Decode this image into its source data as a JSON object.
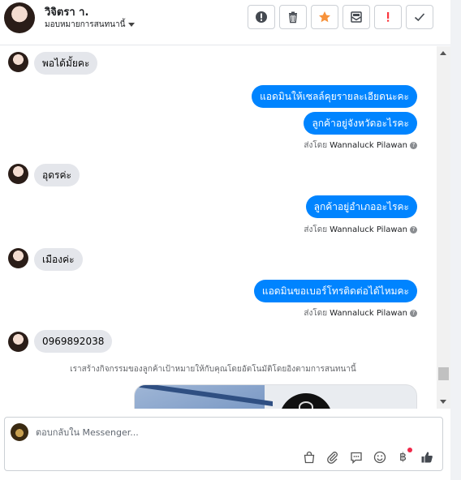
{
  "header": {
    "name": "วิจิตรา า.",
    "assign_label": "มอบหมายการสนทนานี้"
  },
  "toolbar": {
    "buttons": [
      {
        "icon": "alert-circle-icon",
        "color": "#444950"
      },
      {
        "icon": "trash-icon",
        "color": "#444950"
      },
      {
        "icon": "star-icon",
        "color": "#f7923b"
      },
      {
        "icon": "envelope-icon",
        "color": "#444950"
      },
      {
        "icon": "exclamation-icon",
        "color": "#fa383e"
      },
      {
        "icon": "check-icon",
        "color": "#444950"
      }
    ]
  },
  "colors": {
    "outgoing_bubble": "#0084ff",
    "incoming_bubble": "#e4e6eb"
  },
  "messages": [
    {
      "dir": "in",
      "text": "พอได้มั้ยคะ"
    },
    {
      "dir": "out",
      "text": "แอดมินให้เซลล์คุยรายละเอียดนะคะ"
    },
    {
      "dir": "out",
      "text": "ลูกค้าอยู่จังหวัดอะไรคะ"
    },
    {
      "dir": "in",
      "text": "อุดรค่ะ"
    },
    {
      "dir": "out",
      "text": "ลูกค้าอยู่อำเภออะไรคะ"
    },
    {
      "dir": "in",
      "text": "เมืองค่ะ"
    },
    {
      "dir": "out",
      "text": "แอดมินขอเบอร์โทรติดต่อได้ไหมคะ"
    },
    {
      "dir": "in",
      "text": "0969892038"
    }
  ],
  "sent_by": {
    "prefix": "ส่งโดย",
    "name": "Wannaluck Pilawan",
    "help": "?"
  },
  "system_note": "เราสร้างกิจกรรมของลูกค้าเป้าหมายให้กับคุณโดยอัตโนมัติโดยอิงตามการสนทนานี้",
  "composer": {
    "placeholder": "ตอบกลับใน Messenger...",
    "icons": [
      "shopping-bag-icon",
      "paperclip-icon",
      "saved-replies-icon",
      "emoji-icon",
      "baht-payment-icon",
      "thumbs-up-icon"
    ],
    "baht_symbol": "฿"
  }
}
